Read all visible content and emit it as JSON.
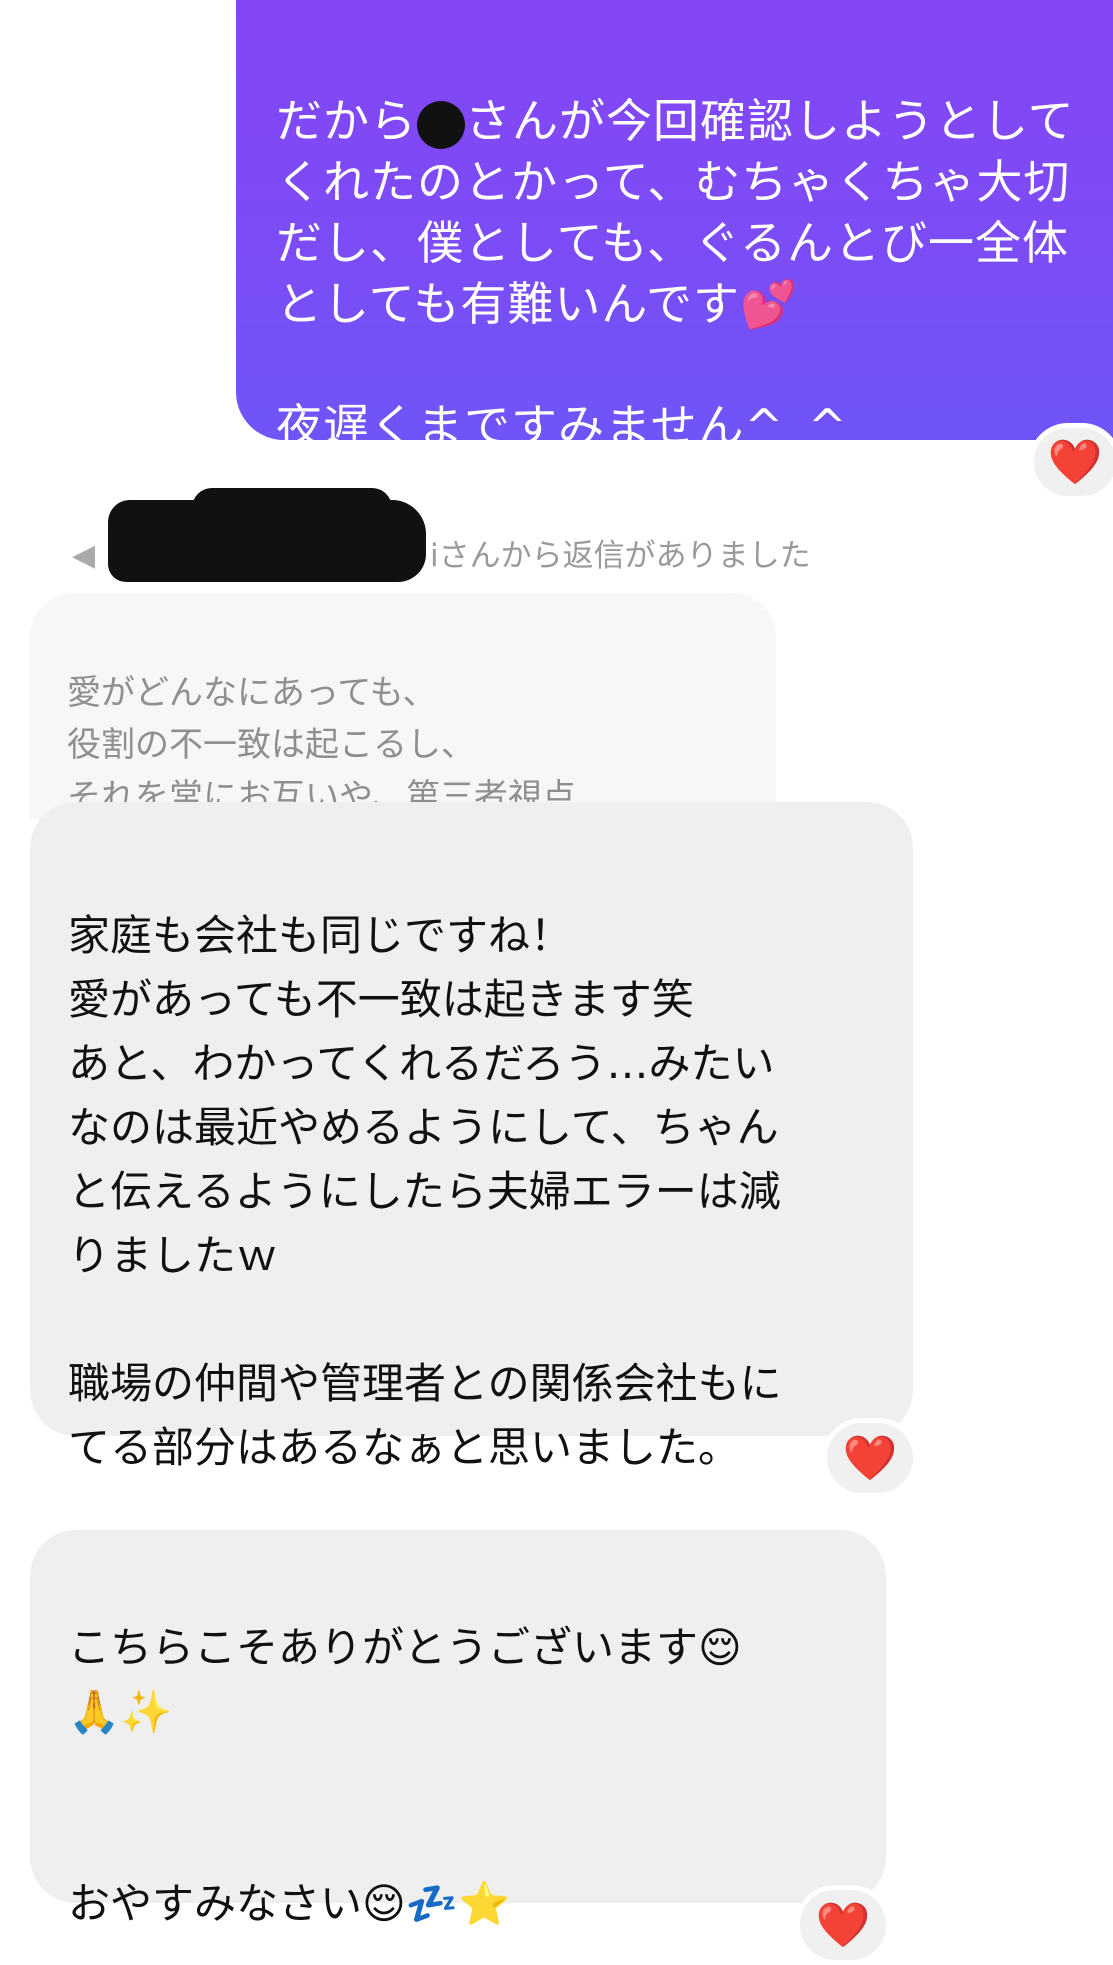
{
  "sent_message": {
    "line1": "だから",
    "line1_rest": "さんが今回確認しようとして",
    "body": "くれたのとかって、むちゃくちゃ大切\nだし、僕としても、ぐるんとび一全体\nとしても有難いんです💕\n\n夜遅くまですみません^_^",
    "reaction": "❤️"
  },
  "reply_header": {
    "arrow": "◀",
    "text": "iさんから返信がありました"
  },
  "quoted_message": {
    "text": "愛がどんなにあっても、\n役割の不一致は起こるし、\nそれを常にお互いや、第三者視点…"
  },
  "received_message_1": {
    "text": "家庭も会社も同じですね！\n愛があっても不一致は起きます笑\nあと、わかってくれるだろう…みたい\nなのは最近やめるようにして、ちゃん\nと伝えるようにしたら夫婦エラーは減\nりましたｗ\n\n職場の仲間や管理者との関係会社もに\nてる部分はあるなぁと思いました。",
    "reaction": "❤️"
  },
  "received_message_2": {
    "text": "こちらこそありがとうございます😌\n🙏✨\n\n\nおやすみなさい😌💤⭐️",
    "reaction": "❤️"
  },
  "colors": {
    "sent_bubble": "#7c4cf6",
    "received_bubble": "#efefef",
    "heart": "#e02020"
  }
}
